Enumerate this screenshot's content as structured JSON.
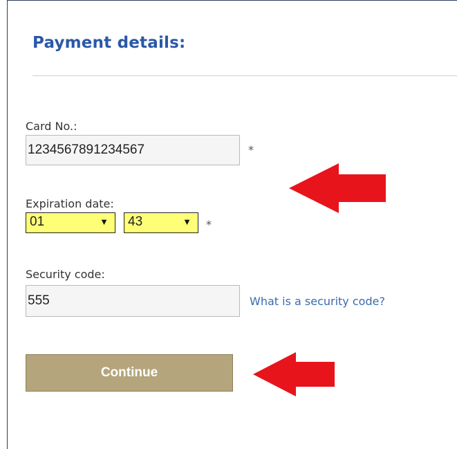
{
  "form": {
    "title": "Payment details:",
    "card": {
      "label": "Card No.:",
      "value": "1234567891234567",
      "required_mark": "*"
    },
    "expiration": {
      "label": "Expiration date:",
      "month": "01",
      "year": "43",
      "required_mark": "*"
    },
    "security": {
      "label": "Security code:",
      "value": "555",
      "help_link": "What is a security code?"
    },
    "continue_label": "Continue"
  },
  "colors": {
    "title": "#2a58a8",
    "select_highlight": "#ffff77",
    "button": "#b4a57c",
    "arrow": "#e8141c",
    "link": "#3a6aad"
  },
  "icons": {
    "select_caret": "caret-down-icon",
    "annotation": "red-arrow-left-icon"
  }
}
